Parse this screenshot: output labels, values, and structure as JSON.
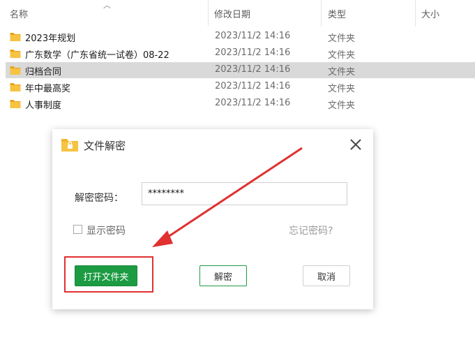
{
  "columns": {
    "name": "名称",
    "date": "修改日期",
    "type": "类型",
    "size": "大小"
  },
  "rows": [
    {
      "name": "2023年规划",
      "date": "2023/11/2 14:16",
      "type": "文件夹",
      "selected": false
    },
    {
      "name": "广东数学（广东省统一试卷）08-22",
      "date": "2023/11/2 14:16",
      "type": "文件夹",
      "selected": false
    },
    {
      "name": "归档合同",
      "date": "2023/11/2 14:16",
      "type": "文件夹",
      "selected": true
    },
    {
      "name": "年中最高奖",
      "date": "2023/11/2 14:16",
      "type": "文件夹",
      "selected": false
    },
    {
      "name": "人事制度",
      "date": "2023/11/2 14:16",
      "type": "文件夹",
      "selected": false
    }
  ],
  "dialog": {
    "title": "文件解密",
    "password_label": "解密密码：",
    "password_value": "********",
    "show_password_label": "显示密码",
    "show_password_checked": false,
    "forgot_password": "忘记密码?",
    "open_folder_button": "打开文件夹",
    "decrypt_button": "解密",
    "cancel_button": "取消"
  },
  "colors": {
    "primary_green": "#1c9b43",
    "highlight_red": "#e03030",
    "folder_yellow": "#f2a516",
    "selected_row": "#d9d9d9"
  },
  "icons": {
    "folder": "folder-icon",
    "locked_folder": "locked-folder-icon",
    "close": "close-icon",
    "sort": "sort-up-arrow-icon"
  }
}
